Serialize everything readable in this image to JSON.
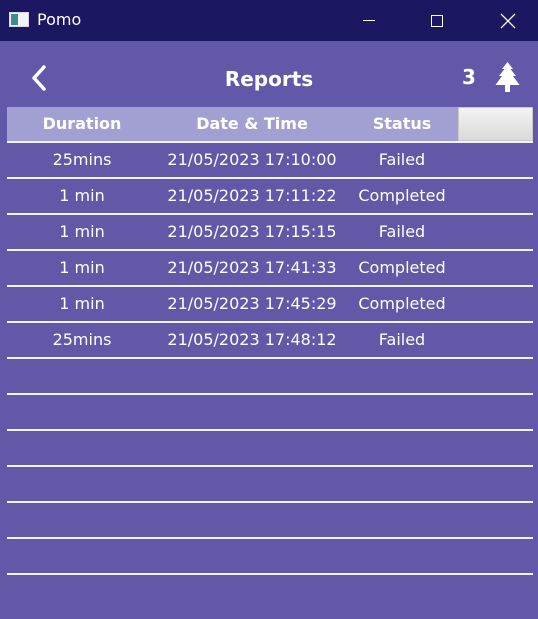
{
  "window": {
    "title": "Pomo",
    "controls": [
      "minimize",
      "maximize",
      "close"
    ]
  },
  "header": {
    "title": "Reports",
    "back_icon": "chevron-left-icon",
    "tree_count": "3",
    "tree_icon": "tree-icon"
  },
  "table": {
    "columns": [
      "Duration",
      "Date & Time",
      "Status"
    ],
    "rows": [
      {
        "duration": "25mins",
        "datetime": "21/05/2023 17:10:00",
        "status": "Failed"
      },
      {
        "duration": "1 min",
        "datetime": "21/05/2023 17:11:22",
        "status": "Completed"
      },
      {
        "duration": "1 min",
        "datetime": "21/05/2023 17:15:15",
        "status": "Failed"
      },
      {
        "duration": "1 min",
        "datetime": "21/05/2023 17:41:33",
        "status": "Completed"
      },
      {
        "duration": "1 min",
        "datetime": "21/05/2023 17:45:29",
        "status": "Completed"
      },
      {
        "duration": "25mins",
        "datetime": "21/05/2023 17:48:12",
        "status": "Failed"
      }
    ],
    "empty_row_count": 6
  },
  "colors": {
    "background": "#6159a8",
    "titlebar": "#1b1760",
    "table_header": "#a29fd3",
    "divider": "#f2f2f8",
    "text": "#ffffff"
  }
}
